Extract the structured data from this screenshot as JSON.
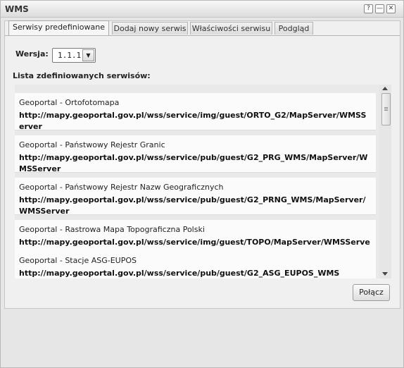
{
  "window": {
    "title": "WMS",
    "help_glyph": "?",
    "minimize_glyph": "—",
    "close_glyph": "✕"
  },
  "tabs": [
    {
      "label": "Serwisy predefiniowane",
      "active": true
    },
    {
      "label": "Dodaj nowy serwis",
      "active": false
    },
    {
      "label": "Właściwości serwisu",
      "active": false
    },
    {
      "label": "Podgląd",
      "active": false
    }
  ],
  "version": {
    "label": "Wersja:",
    "selected": "1.1.1"
  },
  "list": {
    "label": "Lista zdefiniowanych serwisów:",
    "items": [
      {
        "name": "Geoportal - Ortofotomapa",
        "url": "http://mapy.geoportal.gov.pl/wss/service/img/guest/ORTO_G2/MapServer/WMSServer"
      },
      {
        "name": "Geoportal - Państwowy Rejestr Granic",
        "url": "http://mapy.geoportal.gov.pl/wss/service/pub/guest/G2_PRG_WMS/MapServer/WMSServer"
      },
      {
        "name": "Geoportal - Państwowy Rejestr Nazw Geograficznych",
        "url": "http://mapy.geoportal.gov.pl/wss/service/pub/guest/G2_PRNG_WMS/MapServer/WMSServer"
      },
      {
        "name": "Geoportal - Rastrowa Mapa Topograficzna Polski",
        "url": "http://mapy.geoportal.gov.pl/wss/service/img/guest/TOPO/MapServer/WMSServer"
      },
      {
        "name": "Geoportal - Stacje ASG-EUPOS",
        "url": "http://mapy.geoportal.gov.pl/wss/service/pub/guest/G2_ASG_EUPOS_WMS"
      }
    ]
  },
  "connect_button": "Połącz",
  "colors": {
    "window_bg": "#e6e6e6",
    "item_bg": "#fbfbfb",
    "list_bg": "#e9e9e9"
  }
}
